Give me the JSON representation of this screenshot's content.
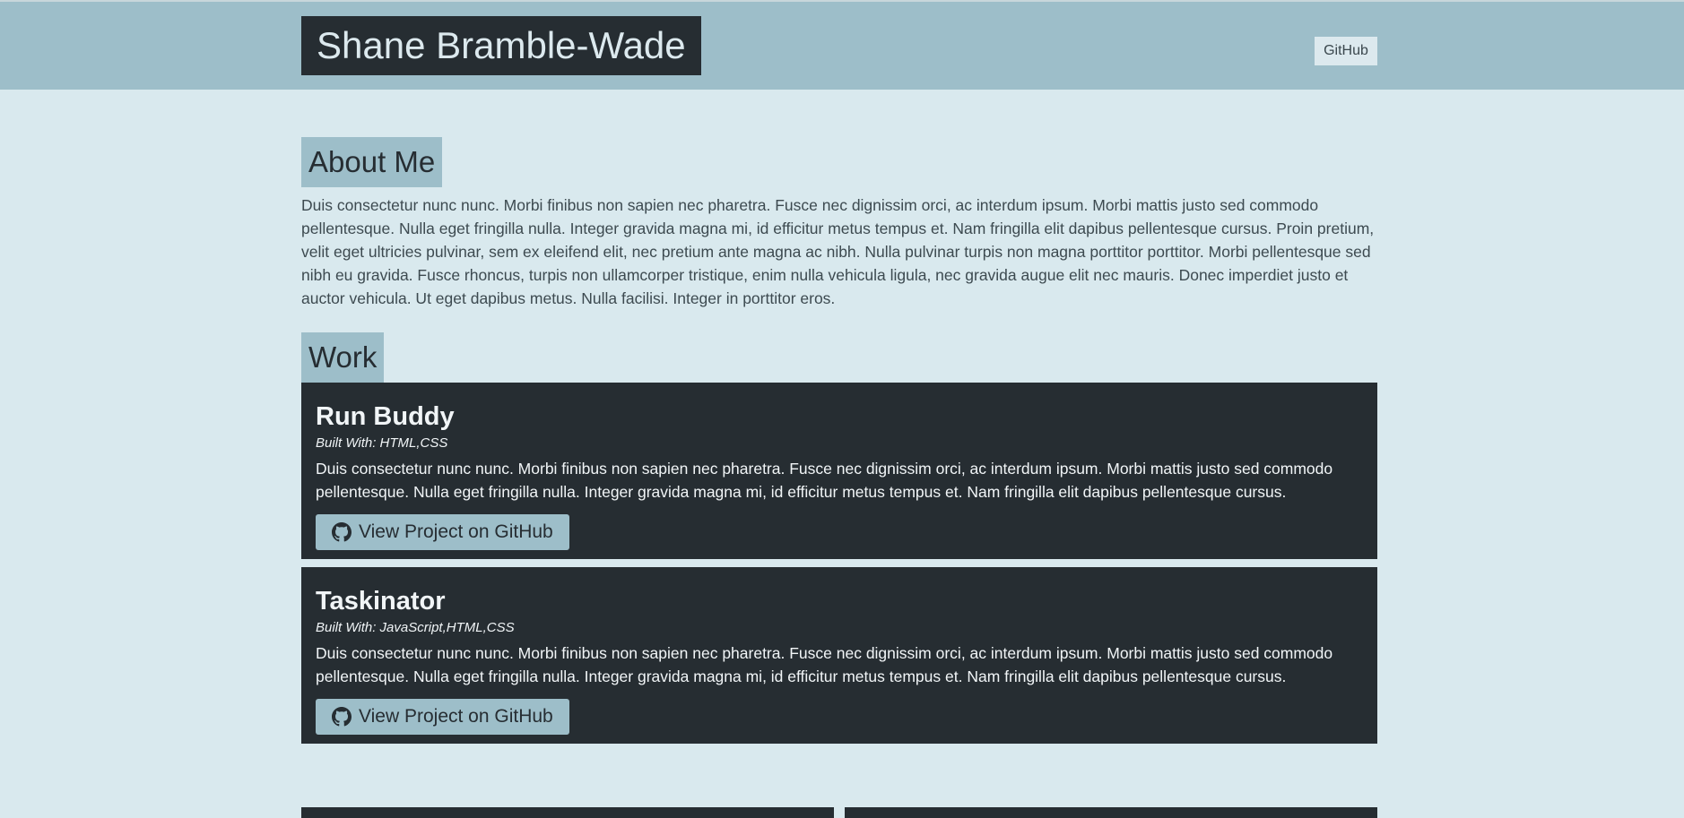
{
  "header": {
    "title": "Shane Bramble-Wade",
    "nav_link": "GitHub"
  },
  "about": {
    "title": "About Me",
    "text": "Duis consectetur nunc nunc. Morbi finibus non sapien nec pharetra. Fusce nec dignissim orci, ac interdum ipsum. Morbi mattis justo sed commodo pellentesque. Nulla eget fringilla nulla. Integer gravida magna mi, id efficitur metus tempus et. Nam fringilla elit dapibus pellentesque cursus. Proin pretium, velit eget ultricies pulvinar, sem ex eleifend elit, nec pretium ante magna ac nibh. Nulla pulvinar turpis non magna porttitor porttitor. Morbi pellentesque sed nibh eu gravida. Fusce rhoncus, turpis non ullamcorper tristique, enim nulla vehicula ligula, nec gravida augue elit nec mauris. Donec imperdiet justo et auctor vehicula. Ut eget dapibus metus. Nulla facilisi. Integer in porttitor eros."
  },
  "work": {
    "title": "Work",
    "projects": [
      {
        "name": "Run Buddy",
        "built_with": "Built With: HTML,CSS",
        "description": "Duis consectetur nunc nunc. Morbi finibus non sapien nec pharetra. Fusce nec dignissim orci, ac interdum ipsum. Morbi mattis justo sed commodo pellentesque. Nulla eget fringilla nulla. Integer gravida magna mi, id efficitur metus tempus et. Nam fringilla elit dapibus pellentesque cursus.",
        "button_label": "View Project on GitHub",
        "button_icon": "github-icon"
      },
      {
        "name": "Taskinator",
        "built_with": "Built With: JavaScript,HTML,CSS",
        "description": "Duis consectetur nunc nunc. Morbi finibus non sapien nec pharetra. Fusce nec dignissim orci, ac interdum ipsum. Morbi mattis justo sed commodo pellentesque. Nulla eget fringilla nulla. Integer gravida magna mi, id efficitur metus tempus et. Nam fringilla elit dapibus pellentesque cursus.",
        "button_label": "View Project on GitHub",
        "button_icon": "github-icon"
      }
    ]
  },
  "colors": {
    "page_background": "#d9e9ee",
    "header_background": "#9dbec9",
    "dark": "#262d32",
    "accent": "#9dbec9"
  }
}
